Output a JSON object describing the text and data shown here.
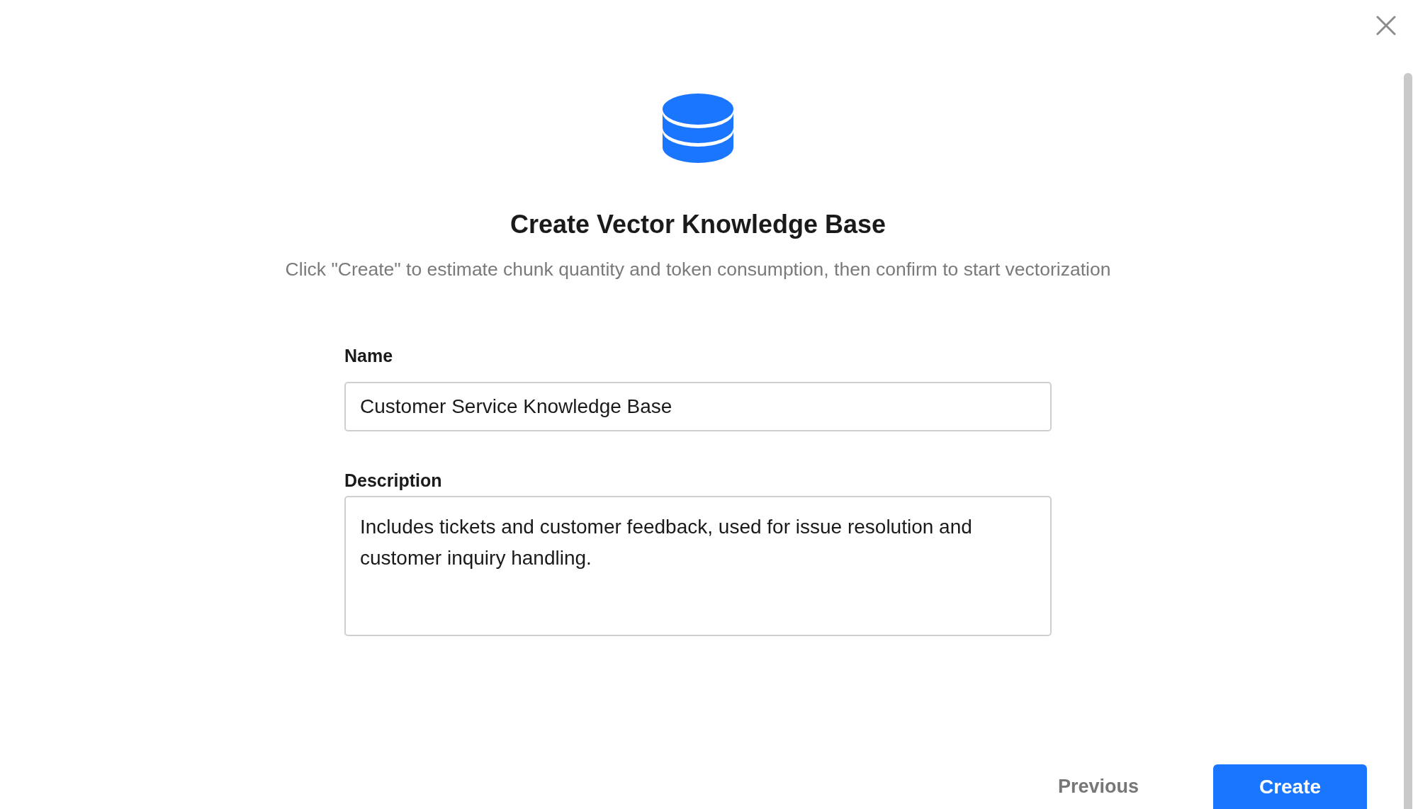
{
  "header": {
    "title": "Create Vector Knowledge Base",
    "subtitle": "Click \"Create\" to estimate chunk quantity and token consumption, then confirm to start vectorization"
  },
  "form": {
    "fields": [
      {
        "kind": "input",
        "label": "Name",
        "value": "Customer Service Knowledge Base"
      },
      {
        "kind": "textarea",
        "label": "Description",
        "value": "Includes tickets and customer feedback, used for issue resolution and customer inquiry handling."
      }
    ]
  },
  "buttons": [
    {
      "kind": "secondary",
      "label": "Previous"
    },
    {
      "kind": "primary",
      "label": "Create"
    }
  ]
}
